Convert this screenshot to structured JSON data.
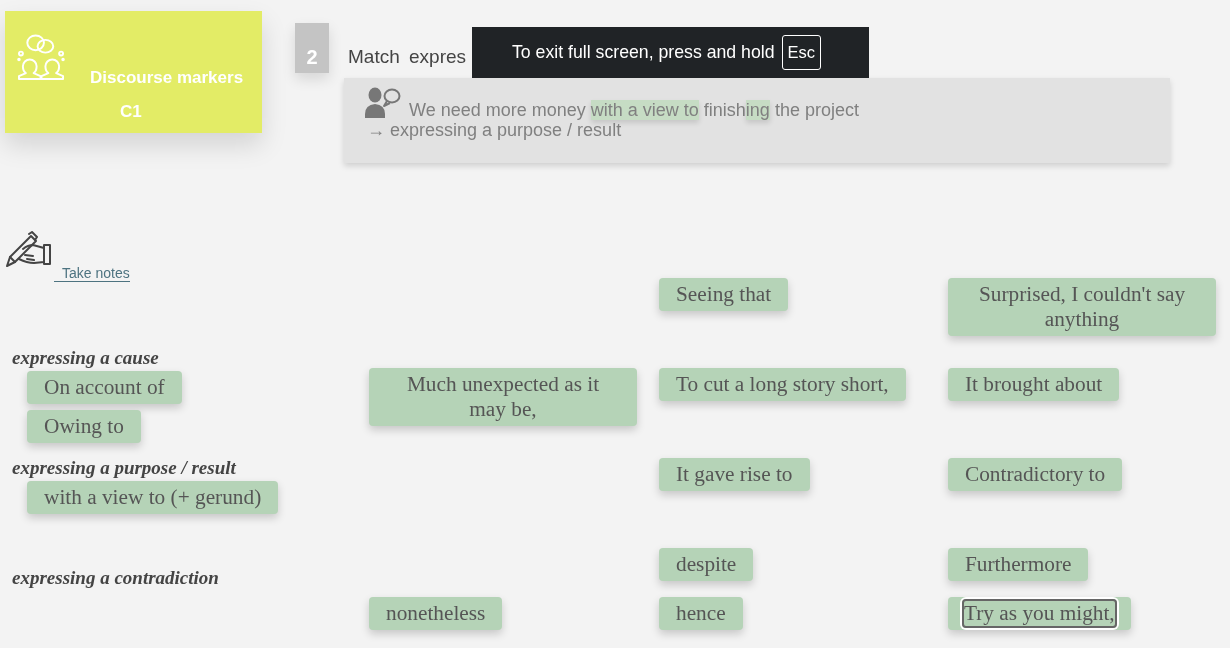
{
  "lesson_card": {
    "title": "Discourse markers",
    "subtitle": "C1"
  },
  "exercise": {
    "number": "2",
    "instruction": "Match expres",
    "example": {
      "sentence": [
        {
          "text": "We need more money ",
          "highlighted": false
        },
        {
          "text": "with a view to",
          "highlighted": true
        },
        {
          "text": " finish",
          "highlighted": false
        },
        {
          "text": "ing",
          "highlighted": true
        },
        {
          "text": " the project",
          "highlighted": false
        }
      ],
      "explanation": "→ expressing a purpose / result"
    }
  },
  "fullscreen_notice": {
    "message": "To exit full screen, press and hold",
    "key": "Esc"
  },
  "notes_link": {
    "label": "Take notes"
  },
  "categories": [
    {
      "title": "expressing a cause",
      "chips": [
        "On account of",
        "Owing to"
      ]
    },
    {
      "title": "expressing a purpose / result",
      "chips": [
        "with a view to (+ gerund)"
      ]
    },
    {
      "title": "expressing a contradiction"
    }
  ],
  "answer_rows": [
    {
      "column_2": {
        "text": "Seeing that",
        "focused": false
      },
      "column_3": {
        "text": "Surprised, I couldn't say anything",
        "focused": false
      }
    },
    {
      "column_1": {
        "text": "Much unexpected as it may be,",
        "focused": false
      },
      "column_2": {
        "text": "To cut a long story short,",
        "focused": false
      },
      "column_3": {
        "text": "It brought about",
        "focused": false
      }
    },
    {
      "column_2": {
        "text": "It gave rise to",
        "focused": false
      },
      "column_3": {
        "text": "Contradictory to",
        "focused": false
      }
    },
    {
      "column_2": {
        "text": "despite",
        "focused": false
      },
      "column_3": {
        "text": "Furthermore",
        "focused": false
      }
    },
    {
      "column_1": {
        "text": "nonetheless",
        "focused": false
      },
      "column_2": {
        "text": "hence",
        "focused": false
      },
      "column_3": {
        "text": "Try as you might,",
        "focused": true
      }
    }
  ]
}
